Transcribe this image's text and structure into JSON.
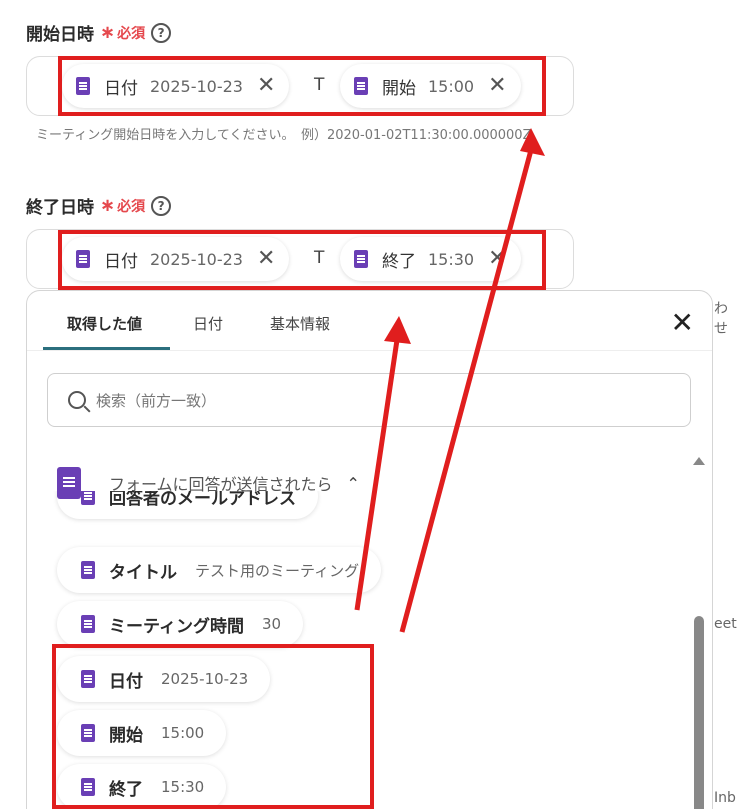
{
  "start_field": {
    "label": "開始日時",
    "required": "必須",
    "help": "?",
    "chip1": {
      "name": "日付",
      "value": "2025-10-23"
    },
    "separator": "T",
    "chip2": {
      "name": "開始",
      "value": "15:00"
    },
    "hint": "ミーティング開始日時を入力してください。　例）2020-01-02T11:30:00.000000Z"
  },
  "end_field": {
    "label": "終了日時",
    "required": "必須",
    "help": "?",
    "chip1": {
      "name": "日付",
      "value": "2025-10-23"
    },
    "separator": "T",
    "chip2": {
      "name": "終了",
      "value": "15:30"
    }
  },
  "panel": {
    "tabs": [
      "取得した値",
      "日付",
      "基本情報"
    ],
    "search_placeholder": "検索（前方一致）",
    "group_title": "フォームに回答が送信されたら",
    "partial_item": "回答者のメールアドレス",
    "items": [
      {
        "name": "タイトル",
        "value": "テスト用のミーティング"
      },
      {
        "name": "ミーティング時間",
        "value": "30"
      },
      {
        "name": "日付",
        "value": "2025-10-23"
      },
      {
        "name": "開始",
        "value": "15:00"
      },
      {
        "name": "終了",
        "value": "15:30"
      }
    ]
  },
  "edge_texts": [
    "わせ",
    "eet",
    "Inb"
  ],
  "colors": {
    "highlight": "#e01e1e",
    "required": "#e5484d",
    "doc_icon": "#6a3fb5",
    "tab_accent": "#2b6f7e"
  }
}
